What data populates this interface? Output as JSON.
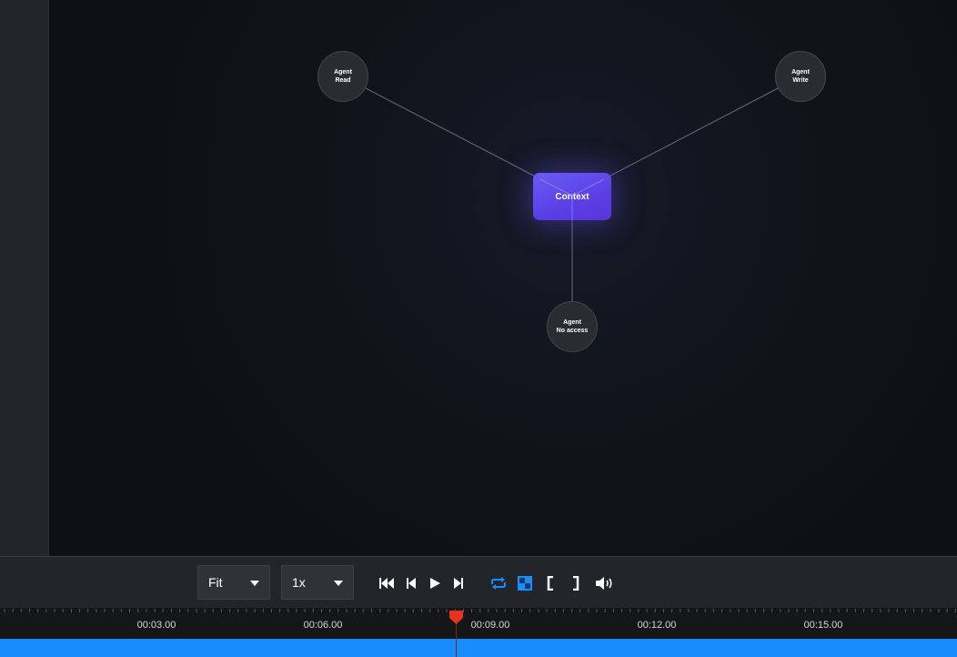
{
  "graph": {
    "nodes": [
      {
        "id": "agent-read",
        "line1": "Agent",
        "line2": "Read"
      },
      {
        "id": "agent-write",
        "line1": "Agent",
        "line2": "Write"
      },
      {
        "id": "agent-no-access",
        "line1": "Agent",
        "line2": "No access"
      }
    ],
    "context_label": "Context"
  },
  "controls": {
    "zoom_value": "Fit",
    "speed_value": "1x",
    "icons": [
      "skip-to-start-icon",
      "step-back-icon",
      "play-icon",
      "step-forward-icon",
      "loop-icon",
      "transparency-grid-icon",
      "mark-in-icon",
      "mark-out-icon",
      "volume-icon"
    ],
    "accent_color": "#1a8cff"
  },
  "timeline": {
    "ticks": [
      "00:03.00",
      "00:06.00",
      "00:09.00",
      "00:12.00",
      "00:15.00"
    ],
    "playhead_color": "#e8321e",
    "track_color": "#1a8cff"
  }
}
